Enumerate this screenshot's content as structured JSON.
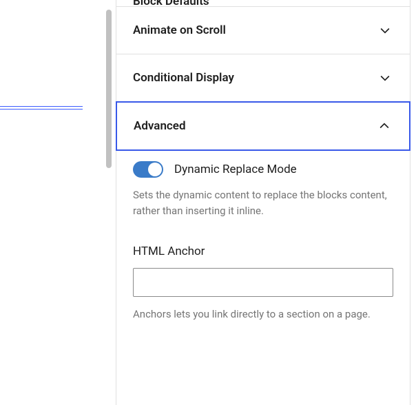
{
  "panels": {
    "block_defaults": {
      "label": "Block Defaults",
      "expanded": false
    },
    "animate_on_scroll": {
      "label": "Animate on Scroll",
      "expanded": false
    },
    "conditional_display": {
      "label": "Conditional Display",
      "expanded": false
    },
    "advanced": {
      "label": "Advanced",
      "expanded": true
    }
  },
  "advanced": {
    "dynamic_replace": {
      "label": "Dynamic Replace Mode",
      "enabled": true,
      "help": "Sets the dynamic content to replace the blocks content, rather than inserting it inline."
    },
    "html_anchor": {
      "label": "HTML Anchor",
      "value": "",
      "help": "Anchors lets you link directly to a section on a page."
    }
  },
  "colors": {
    "accent": "#3858e9",
    "toggle_on": "#3a7bc8"
  }
}
